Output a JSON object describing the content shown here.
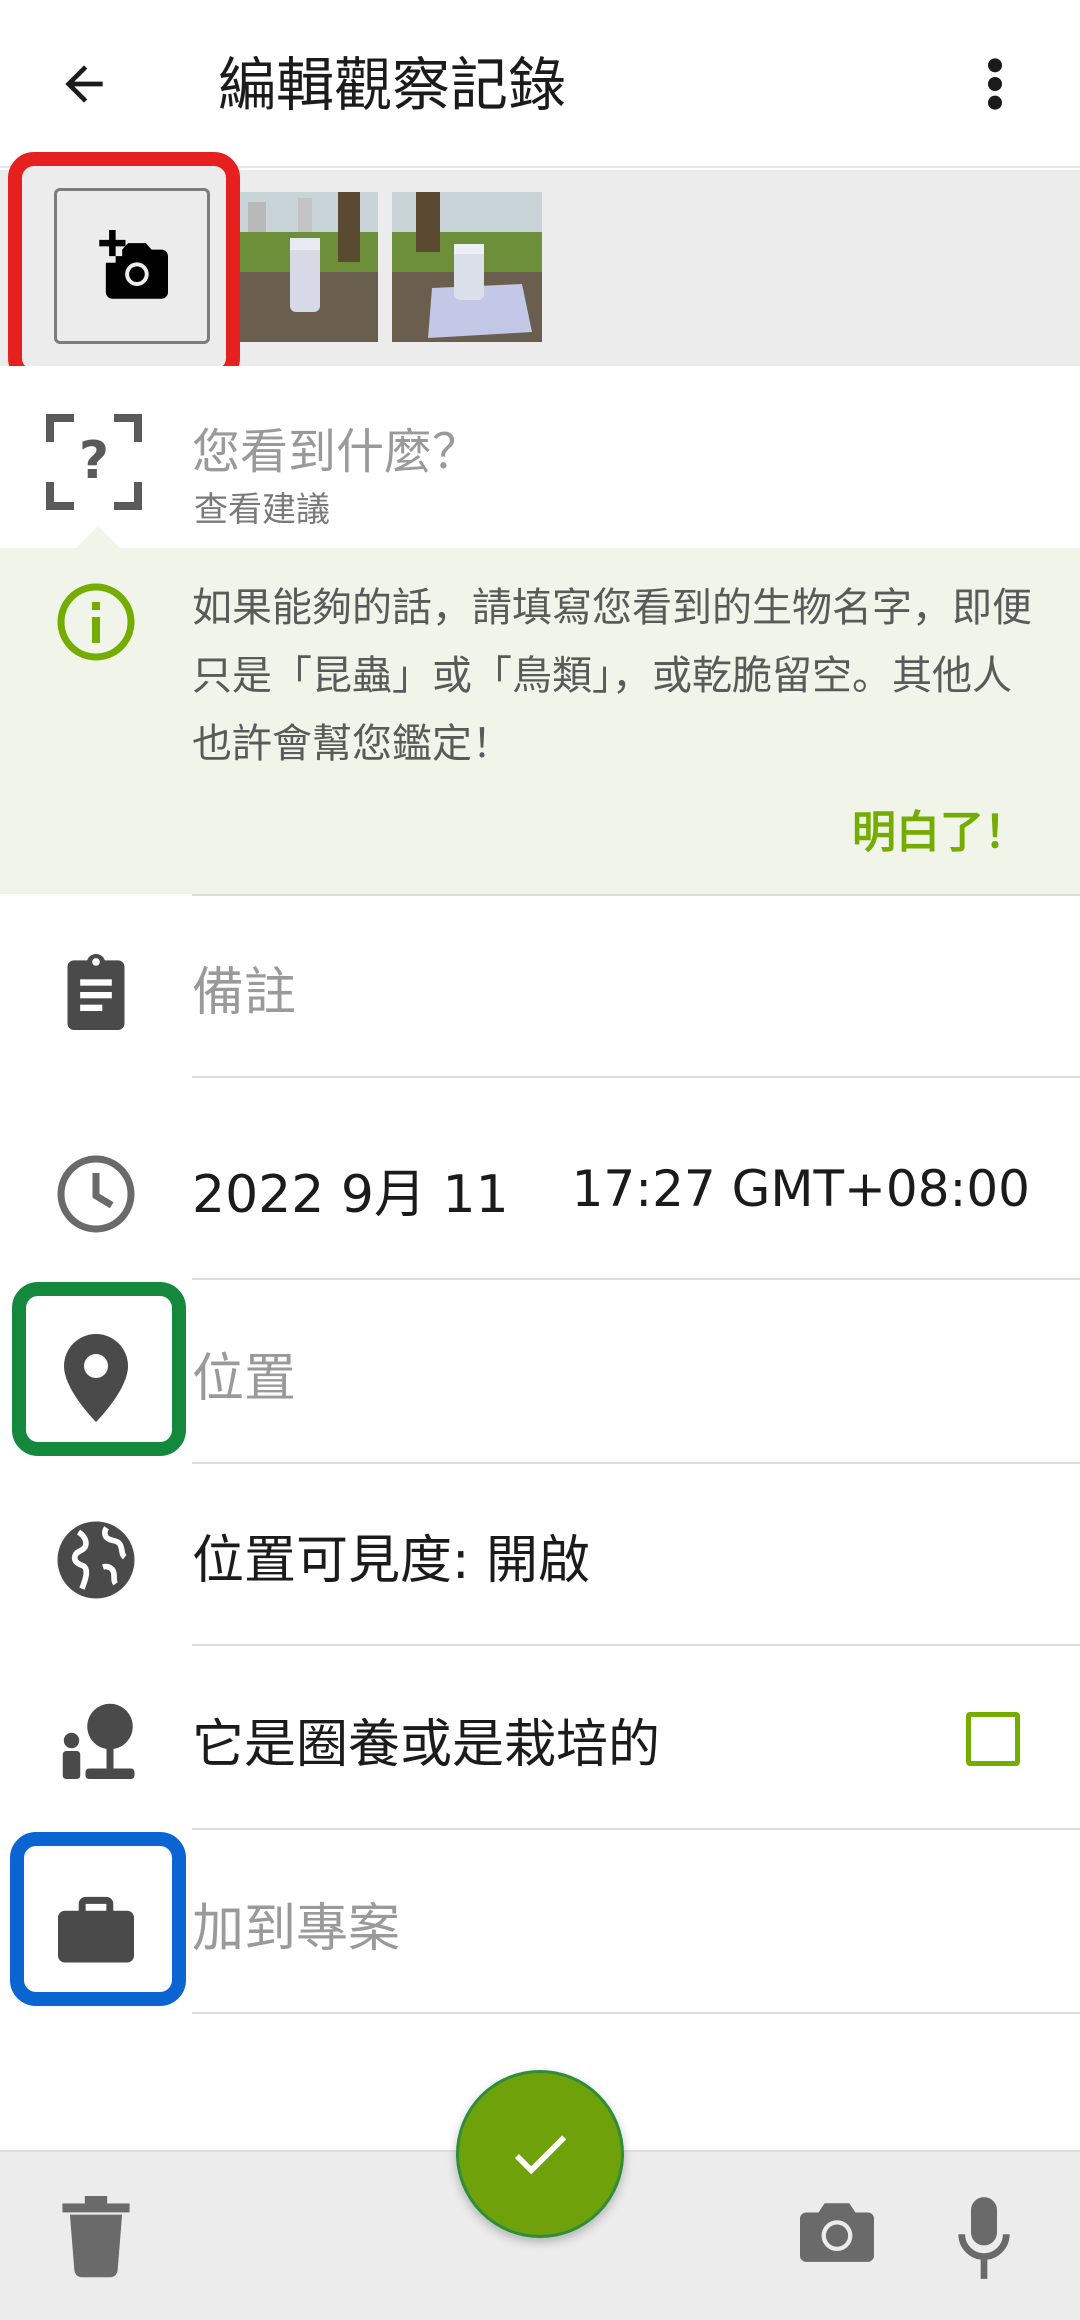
{
  "app_bar": {
    "title": "編輯觀察記錄",
    "back_icon": "arrow-left-icon",
    "menu_icon": "more-vert-icon"
  },
  "photos": {
    "add_icon": "add-photo-camera-icon",
    "thumbnails": [
      "photo-thumbnail-1",
      "photo-thumbnail-2"
    ]
  },
  "species": {
    "question": "您看到什麼？",
    "suggestion": "查看建議"
  },
  "tip": {
    "text": "如果能夠的話，請填寫您看到的生物名字，即便只是「昆蟲」或「鳥類」，或乾脆留空。其他人也許會幫您鑑定！",
    "ok_label": "明白了！"
  },
  "rows": {
    "notes": {
      "placeholder": "備註"
    },
    "datetime": {
      "date": "2022 9月 11",
      "time": "17:27 GMT+08:00"
    },
    "location": {
      "placeholder": "位置"
    },
    "visibility": {
      "label": "位置可見度: 開啟"
    },
    "captive": {
      "label": "它是圈養或是栽培的",
      "checked": false
    },
    "project": {
      "placeholder": "加到專案"
    }
  },
  "colors": {
    "accent": "#74ac00",
    "fab": "#6ea10a",
    "highlight_red": "#e5201f",
    "highlight_green": "#14883d",
    "highlight_blue": "#0a64d1"
  }
}
